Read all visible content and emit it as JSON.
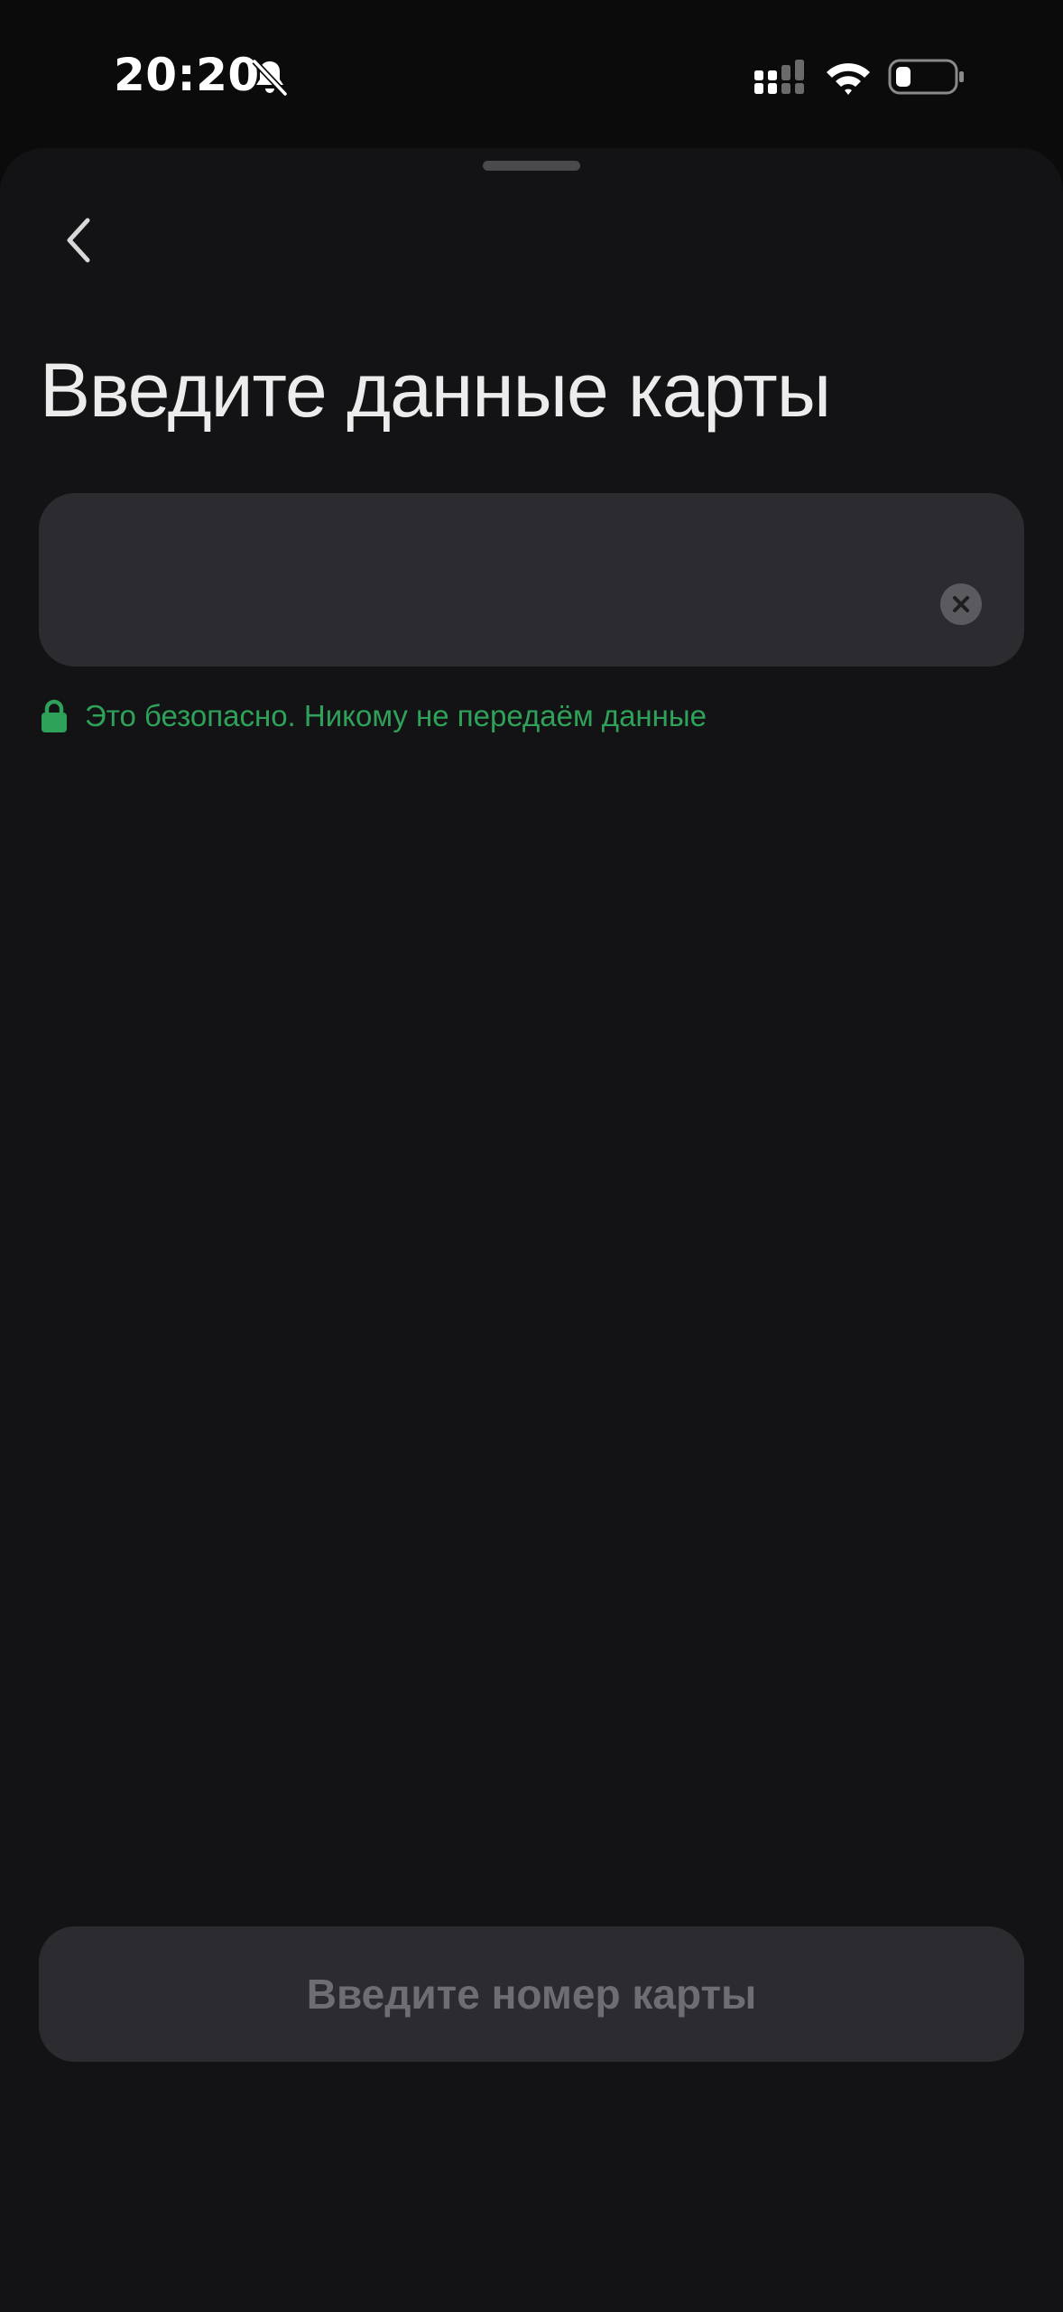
{
  "status_bar": {
    "time": "20:20",
    "icons": [
      "bell-slash-icon",
      "signal-icon",
      "wifi-icon",
      "battery-icon"
    ]
  },
  "header": {
    "back_icon": "chevron-left-icon"
  },
  "main": {
    "title": "Введите данные карты",
    "card_input": {
      "value": "",
      "placeholder": "",
      "clear_icon": "clear-icon"
    },
    "secure_note": {
      "icon": "lock-icon",
      "text": "Это безопасно. Никому не передаём данные"
    }
  },
  "footer": {
    "submit_label": "Введите номер карты"
  },
  "colors": {
    "background": "#0b0b0c",
    "sheet": "#131315",
    "field": "#2c2c30",
    "accent_green": "#2fa25a",
    "title_text": "#ececec",
    "disabled_text": "#6d6d72"
  }
}
